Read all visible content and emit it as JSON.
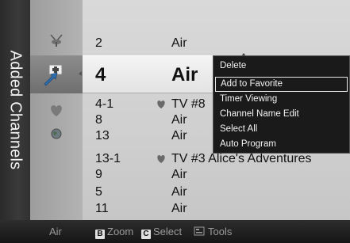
{
  "panel": {
    "title": "Added Channels"
  },
  "categories": [
    {
      "name": "antenna-icon"
    },
    {
      "name": "added-channels-icon"
    },
    {
      "name": "favorites-heart-icon"
    },
    {
      "name": "globe-icon"
    }
  ],
  "channels": [
    {
      "number": "2",
      "name": "Air",
      "favorite": false
    },
    {
      "number": "4",
      "name": "Air",
      "favorite": false,
      "selected": true
    },
    {
      "number": "4-1",
      "name": "TV #8",
      "favorite": true
    },
    {
      "number": "8",
      "name": "Air",
      "favorite": false
    },
    {
      "number": "13",
      "name": "Air",
      "favorite": false
    },
    {
      "number": "13-1",
      "name": "TV #3 Alice's Adventures",
      "favorite": true
    },
    {
      "number": "9",
      "name": "Air",
      "favorite": false
    },
    {
      "number": "5",
      "name": "Air",
      "favorite": false
    },
    {
      "number": "11",
      "name": "Air",
      "favorite": false
    }
  ],
  "tools_menu": {
    "items": [
      "Delete",
      "Add to Favorite",
      "Timer Viewing",
      "Channel Name Edit",
      "Select All",
      "Auto Program"
    ],
    "highlighted": "Add to Favorite"
  },
  "bottom_bar": {
    "source": "Air",
    "zoom_key": "B",
    "zoom_label": "Zoom",
    "select_key": "C",
    "select_label": "Select",
    "tools_label": "Tools"
  },
  "colors": {
    "accent": "#e8e8e8",
    "menu_bg": "#1a1a1a",
    "heart": "#6a6a6a"
  }
}
